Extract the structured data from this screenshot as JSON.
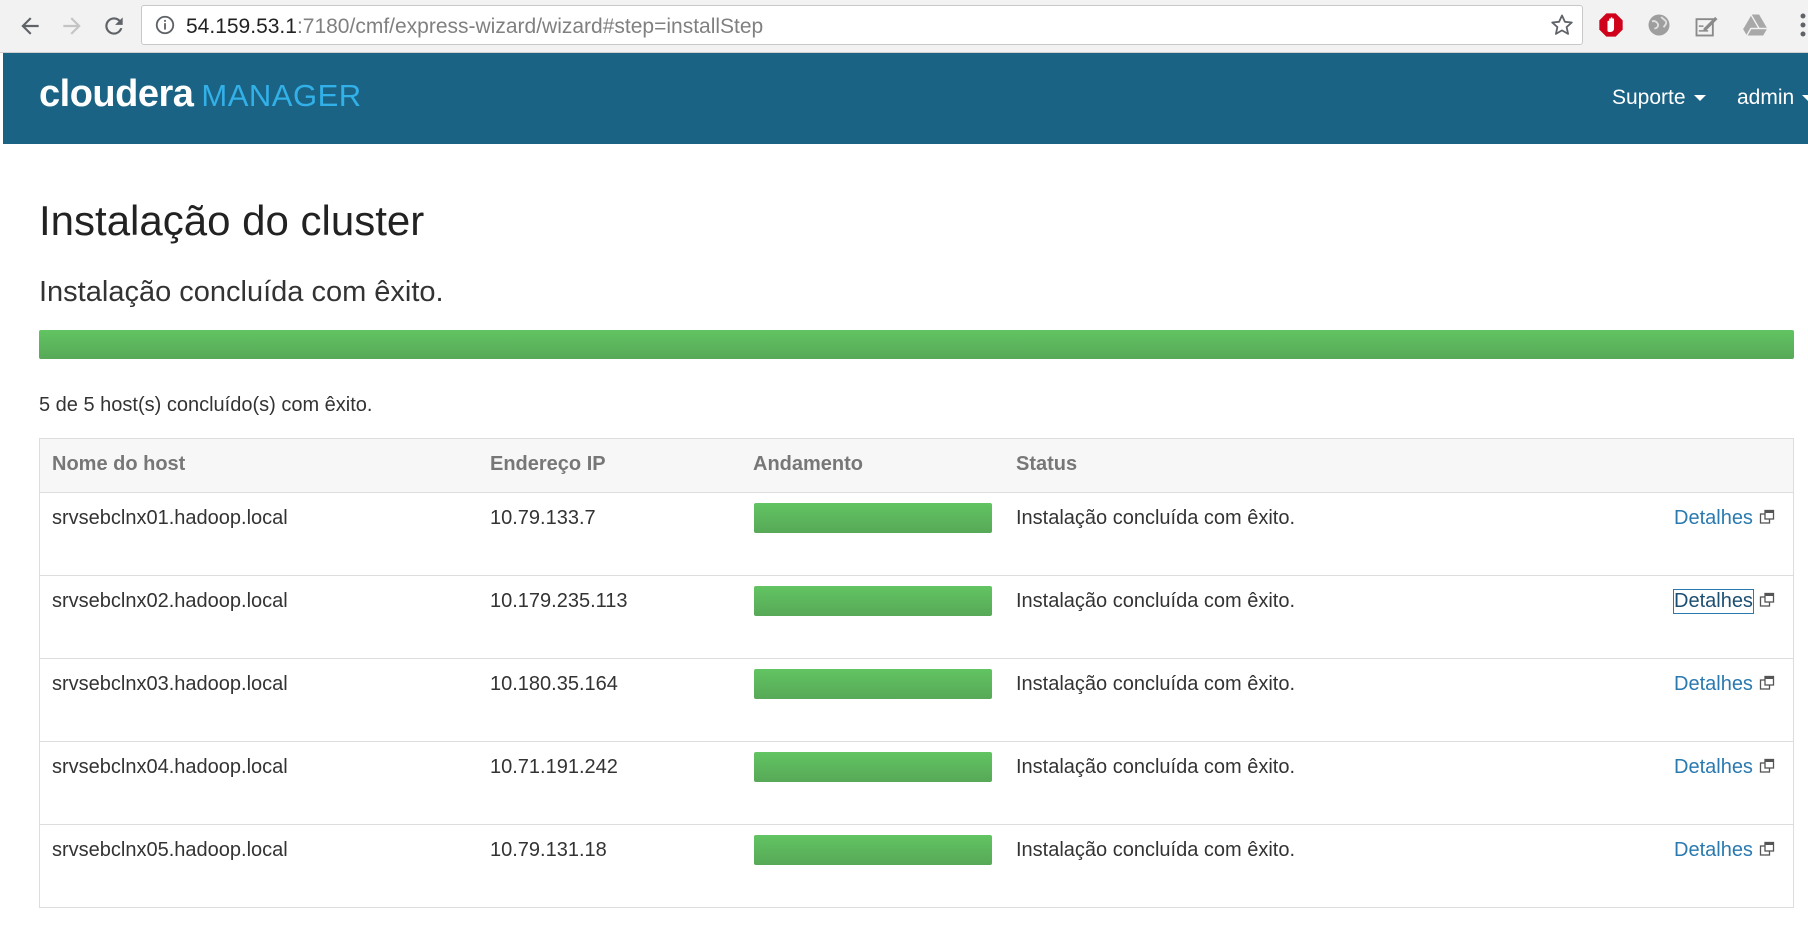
{
  "browser": {
    "url_host": "54.159.53.1",
    "url_rest": ":7180/cmf/express-wizard/wizard#step=installStep"
  },
  "header": {
    "logo_primary": "cloudera",
    "logo_secondary": "MANAGER",
    "support_menu": "Suporte",
    "user_menu": "admin",
    "colors": {
      "header_bg": "#1b6385",
      "logo_accent": "#32b0e8"
    }
  },
  "page": {
    "title": "Instalação do cluster",
    "subtitle": "Instalação concluída com êxito.",
    "overall_progress": 1.0,
    "summary": "5 de 5 host(s) concluído(s) com êxito."
  },
  "table": {
    "columns": {
      "host": "Nome do host",
      "ip": "Endereço IP",
      "progress": "Andamento",
      "status": "Status"
    },
    "rows": [
      {
        "host": "srvsebclnx01.hadoop.local",
        "ip": "10.79.133.7",
        "progress": 1.0,
        "status": "Instalação concluída com êxito.",
        "details": "Detalhes"
      },
      {
        "host": "srvsebclnx02.hadoop.local",
        "ip": "10.179.235.113",
        "progress": 1.0,
        "status": "Instalação concluída com êxito.",
        "details": "Detalhes"
      },
      {
        "host": "srvsebclnx03.hadoop.local",
        "ip": "10.180.35.164",
        "progress": 1.0,
        "status": "Instalação concluída com êxito.",
        "details": "Detalhes"
      },
      {
        "host": "srvsebclnx04.hadoop.local",
        "ip": "10.71.191.242",
        "progress": 1.0,
        "status": "Instalação concluída com êxito.",
        "details": "Detalhes"
      },
      {
        "host": "srvsebclnx05.hadoop.local",
        "ip": "10.79.131.18",
        "progress": 1.0,
        "status": "Instalação concluída com êxito.",
        "details": "Detalhes"
      }
    ]
  },
  "colors": {
    "progress_green": "#5cb85c",
    "link": "#2a7ab0"
  },
  "icons": {
    "back": "back-arrow-icon",
    "forward": "forward-arrow-icon",
    "reload": "reload-icon",
    "info": "info-icon",
    "bookmark": "star-icon",
    "external_link": "external-link-icon"
  }
}
